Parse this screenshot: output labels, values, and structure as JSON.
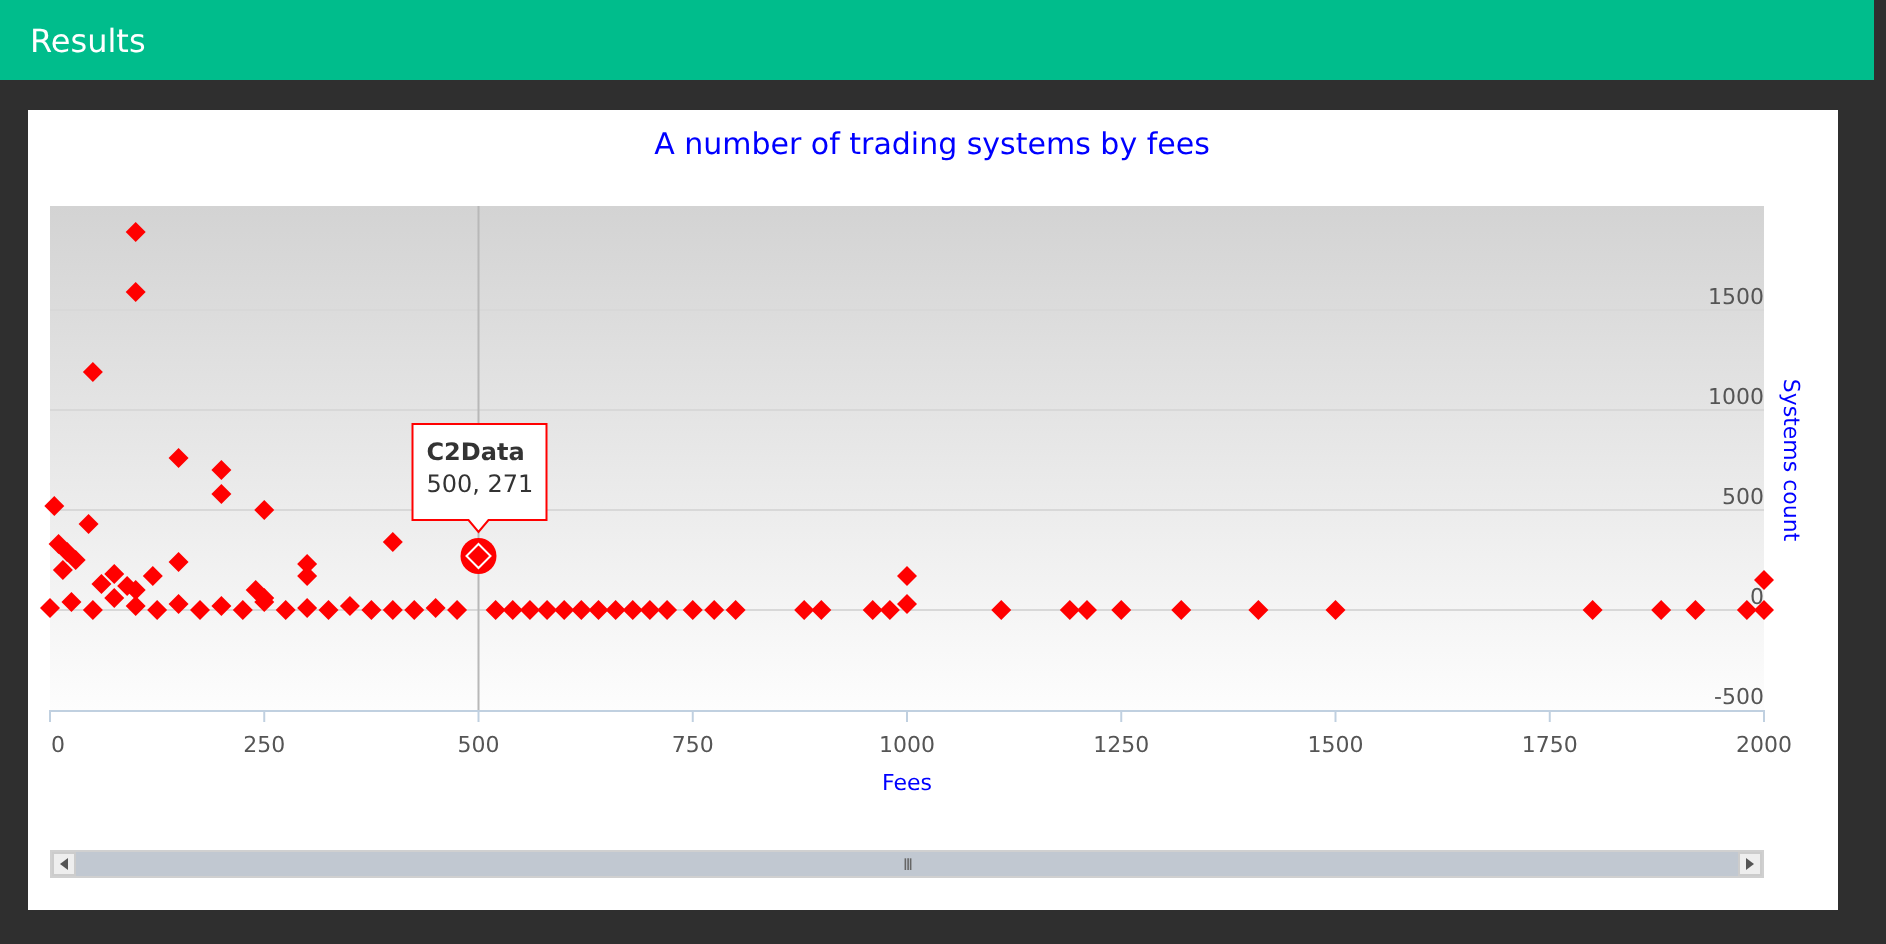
{
  "header": {
    "title": "Results"
  },
  "chart": {
    "chart_data": {
      "type": "scatter",
      "title": "A number of trading systems by fees",
      "xlabel": "Fees",
      "ylabel": "Systems count",
      "xlim": [
        0,
        2000
      ],
      "ylim": [
        -500,
        2020
      ],
      "grid": true,
      "xticks": [
        0,
        250,
        500,
        750,
        1000,
        1250,
        1500,
        1750,
        2000
      ],
      "yticks": [
        -500,
        0,
        500,
        1000,
        1500
      ],
      "x": [
        100,
        100,
        50,
        150,
        200,
        200,
        250,
        5,
        45,
        400,
        300,
        300,
        1000,
        2000,
        10,
        20,
        30,
        15,
        60,
        75,
        90,
        100,
        120,
        150,
        240,
        250,
        0,
        25,
        50,
        75,
        100,
        125,
        150,
        175,
        200,
        225,
        250,
        275,
        300,
        325,
        350,
        375,
        400,
        425,
        450,
        475,
        520,
        540,
        560,
        580,
        600,
        620,
        640,
        660,
        680,
        700,
        720,
        750,
        775,
        800,
        880,
        900,
        960,
        980,
        1000,
        1110,
        1190,
        1210,
        1250,
        1320,
        1410,
        1500,
        1800,
        1880,
        1920,
        1980,
        2000
      ],
      "series": [
        {
          "name": "C2Data",
          "color": "#ff0000",
          "values": [
            1890,
            1590,
            1190,
            760,
            700,
            580,
            500,
            520,
            430,
            340,
            230,
            170,
            170,
            150,
            330,
            290,
            250,
            200,
            130,
            180,
            120,
            100,
            170,
            240,
            100,
            60,
            10,
            40,
            0,
            60,
            20,
            0,
            30,
            0,
            20,
            0,
            40,
            0,
            10,
            0,
            20,
            0,
            0,
            0,
            10,
            0,
            0,
            0,
            0,
            0,
            0,
            0,
            0,
            0,
            0,
            0,
            0,
            0,
            0,
            0,
            0,
            0,
            0,
            0,
            30,
            0,
            0,
            0,
            0,
            0,
            0,
            0,
            0,
            0,
            0,
            0,
            0
          ]
        }
      ],
      "ref_lines": [
        {
          "axis": "x",
          "value": 500
        }
      ],
      "annotations": [
        {
          "x": 500,
          "y": 270,
          "text": "500, 271"
        }
      ]
    }
  },
  "scrollbar": {
    "thumb_label": "III"
  }
}
